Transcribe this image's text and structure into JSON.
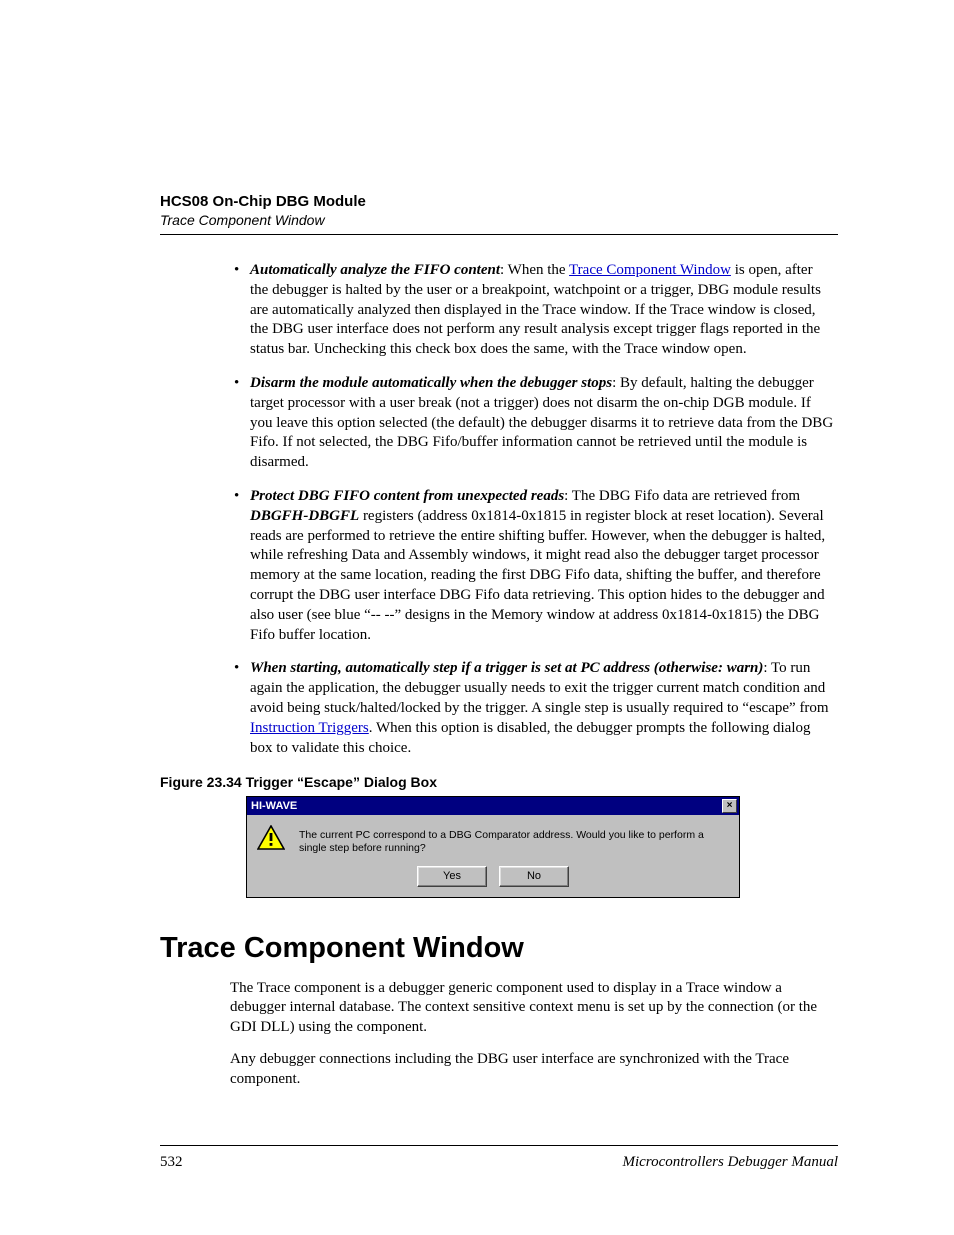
{
  "header": {
    "chapter": "HCS08 On-Chip DBG Module",
    "section": "Trace Component Window"
  },
  "bullets": [
    {
      "lead": "Automatically analyze the FIFO content",
      "a": ": When the ",
      "link": "Trace Component Window",
      "b": " is open, after the debugger is halted by the user or a breakpoint, watchpoint or a trigger, DBG module results are automatically analyzed then displayed in the Trace window. If the Trace window is closed, the DBG user interface does not perform any result analysis except trigger flags reported in the status bar. Unchecking this check box does the same, with the Trace window open."
    },
    {
      "lead": "Disarm the module automatically when the debugger stops",
      "a": ": By default, halting the debugger target processor with a user break (not a trigger) does not disarm the on-chip DGB module. If you leave this option selected (the default) the debugger disarms it to retrieve data from the DBG Fifo. If not selected, the DBG Fifo/buffer information cannot be retrieved until the module is disarmed."
    },
    {
      "lead": "Protect DBG FIFO content from unexpected reads",
      "a": ": The DBG Fifo data are retrieved from ",
      "em": "DBGFH-DBGFL",
      "b": " registers (address 0x1814-0x1815 in register block at reset location). Several reads are performed to retrieve the entire shifting buffer. However, when the debugger is halted, while refreshing Data and Assembly windows, it might read also the debugger target processor memory at the same location, reading the first DBG Fifo data, shifting the buffer, and therefore corrupt the DBG user interface DBG Fifo data retrieving. This option hides to the debugger and also user (see blue “-- --” designs in the Memory window at address 0x1814-0x1815) the DBG Fifo buffer location."
    },
    {
      "lead": "When starting, automatically step if a trigger is set at PC address (otherwise: warn)",
      "a": ": To run again the application, the debugger usually needs to exit the trigger current match condition and avoid being stuck/halted/locked by the trigger. A single step is usually required to “escape” from ",
      "link": "Instruction Triggers",
      "b": ". When this option is disabled, the debugger prompts the following dialog box to validate this choice."
    }
  ],
  "figure": {
    "caption": "Figure 23.34  Trigger “Escape” Dialog Box",
    "dialog": {
      "title": "HI-WAVE",
      "close": "×",
      "message": "The current PC correspond to a DBG Comparator address. Would you like to perform a single step before running?",
      "yes": "Yes",
      "no": "No"
    }
  },
  "section_heading": "Trace Component Window",
  "paras": [
    "The Trace component is a debugger generic component used to display in a Trace window a debugger internal database. The context sensitive context menu is set up by the connection (or the GDI DLL) using the component.",
    "Any debugger connections including the DBG user interface are synchronized with the Trace component."
  ],
  "footer": {
    "page": "532",
    "manual": "Microcontrollers Debugger Manual"
  }
}
